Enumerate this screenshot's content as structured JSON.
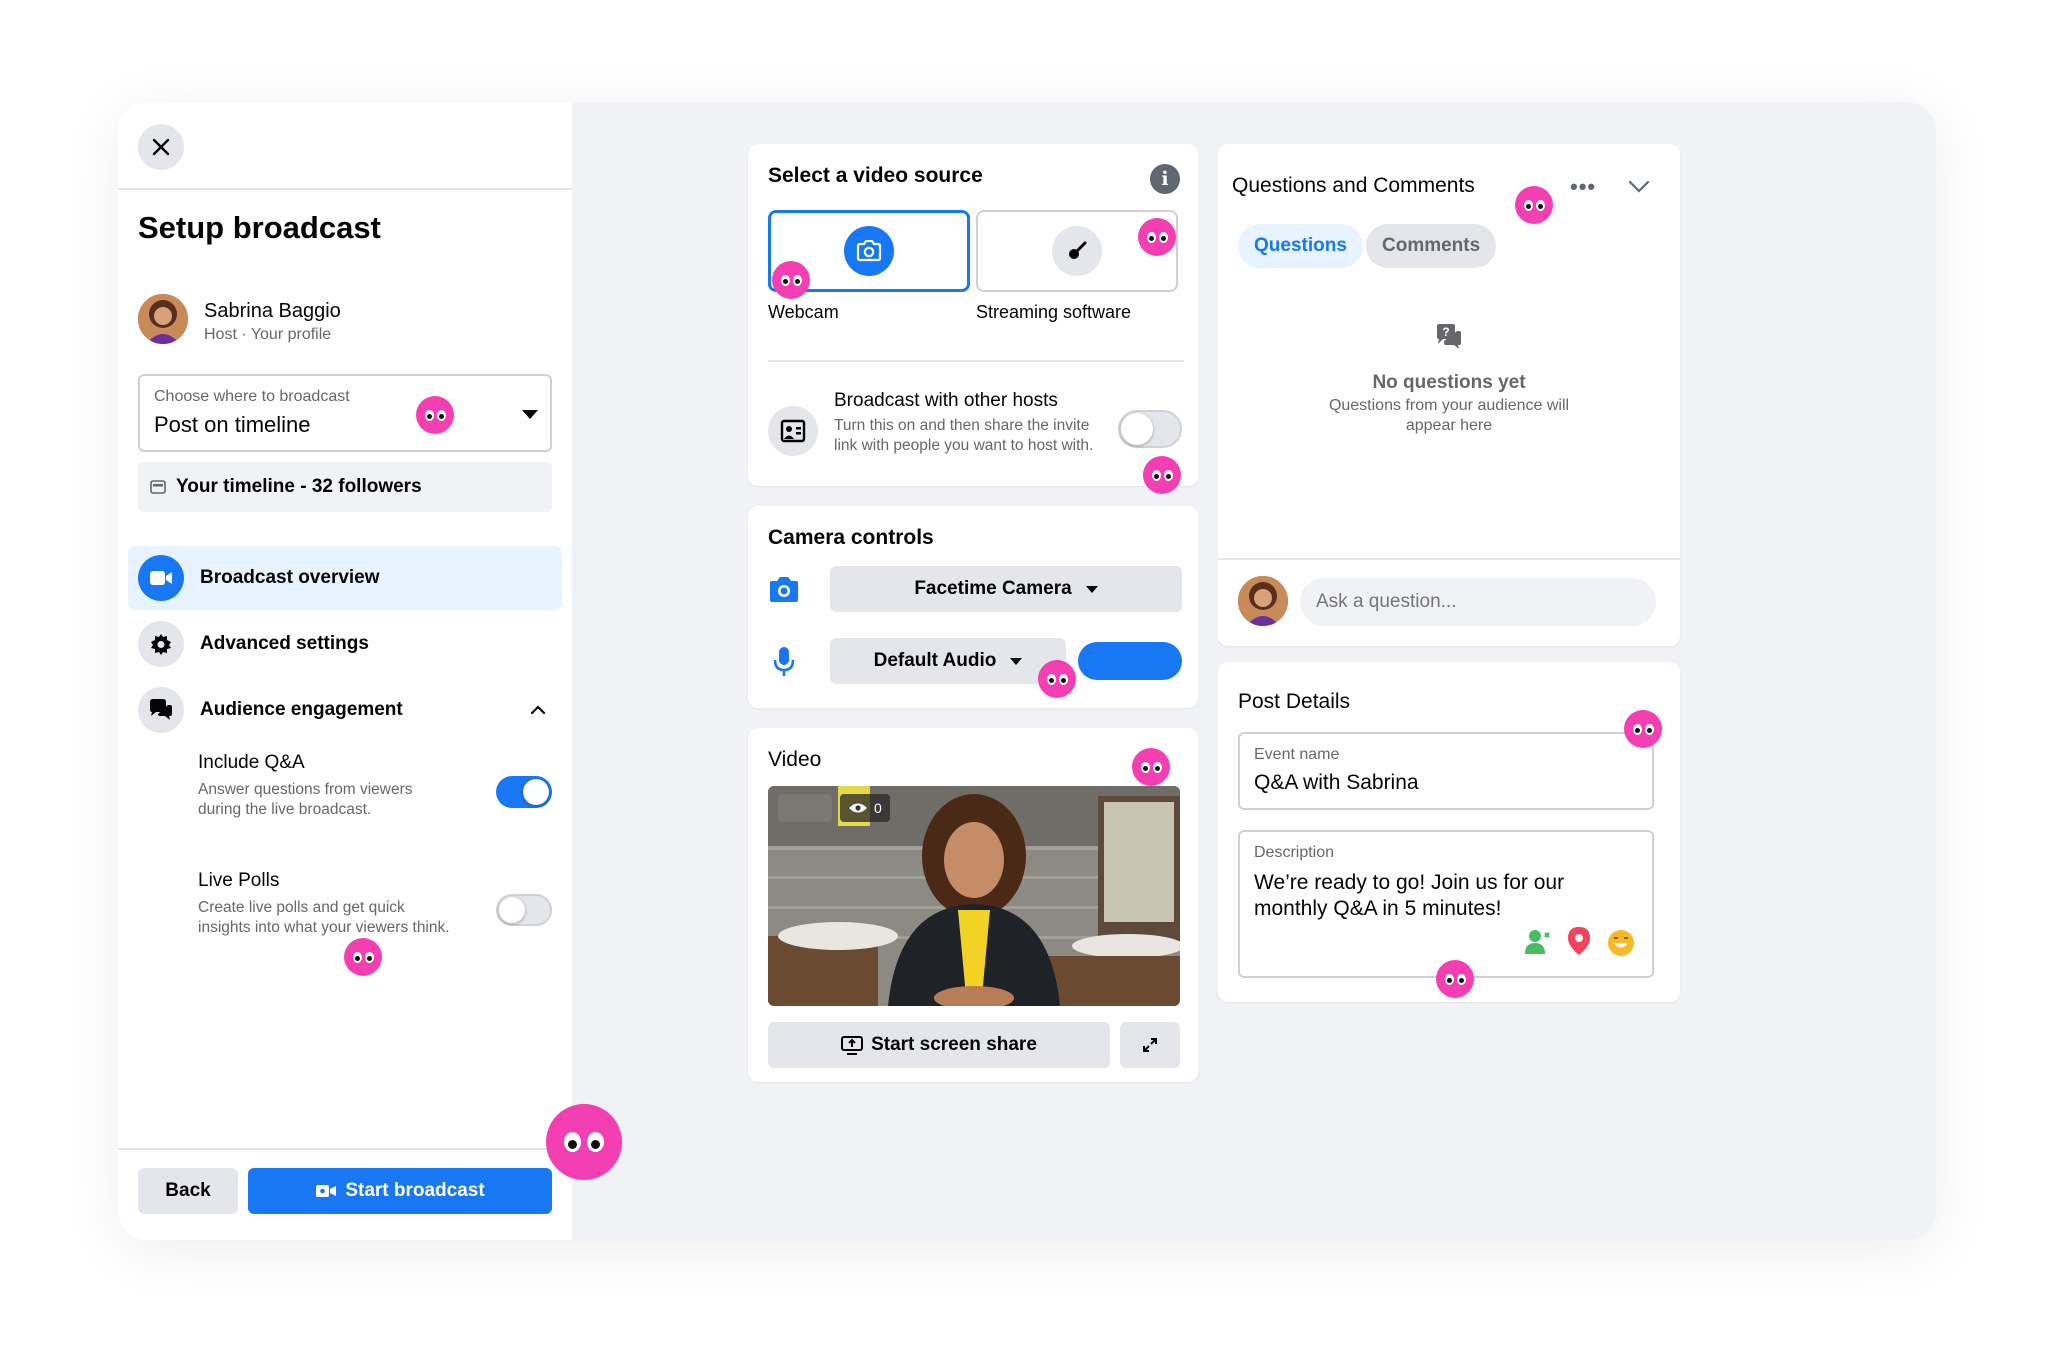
{
  "colors": {
    "accent": "#1877f2",
    "tag": "#f43fb2",
    "panel_bg": "#f0f2f5"
  },
  "sidebar": {
    "title": "Setup broadcast",
    "host": {
      "name": "Sabrina Baggio",
      "subtitle": "Host · Your profile"
    },
    "destination": {
      "label": "Choose where to broadcast",
      "value": "Post on timeline"
    },
    "audience_note": "Your timeline - 32 followers",
    "nav": [
      {
        "label": "Broadcast overview",
        "icon": "video-camera-icon",
        "active": true
      },
      {
        "label": "Advanced settings",
        "icon": "gear-icon",
        "active": false
      },
      {
        "label": "Audience engagement",
        "icon": "chat-bubbles-icon",
        "active": false
      }
    ],
    "options": [
      {
        "title": "Include Q&A",
        "description": "Answer questions from viewers during the live broadcast.",
        "enabled": true
      },
      {
        "title": "Live Polls",
        "description": "Create live polls and get quick insights into what your viewers think.",
        "enabled": false
      }
    ],
    "back_label": "Back",
    "start_label": "Start broadcast"
  },
  "video_source": {
    "title": "Select a video source",
    "sources": [
      {
        "label": "Webcam",
        "icon": "camera-icon",
        "selected": true
      },
      {
        "label": "Streaming software",
        "icon": "key-icon",
        "selected": false
      }
    ],
    "cohost": {
      "title": "Broadcast with other hosts",
      "description": "Turn this on and then share the invite link with people you want to host with.",
      "enabled": false
    }
  },
  "camera_controls": {
    "title": "Camera controls",
    "camera": "Facetime Camera",
    "audio": "Default Audio"
  },
  "video": {
    "title": "Video",
    "viewer_count": "0",
    "screen_share_label": "Start screen share"
  },
  "qa": {
    "title": "Questions and Comments",
    "tabs": [
      {
        "label": "Questions",
        "active": true
      },
      {
        "label": "Comments",
        "active": false
      }
    ],
    "empty_title": "No questions yet",
    "empty_desc": "Questions from your audience will appear here",
    "input_placeholder": "Ask a question..."
  },
  "post_details": {
    "title": "Post Details",
    "event_label": "Event name",
    "event_value": "Q&A with Sabrina",
    "desc_label": "Description",
    "desc_value": "We’re ready to go! Join us for our monthly Q&A in 5 minutes!"
  }
}
